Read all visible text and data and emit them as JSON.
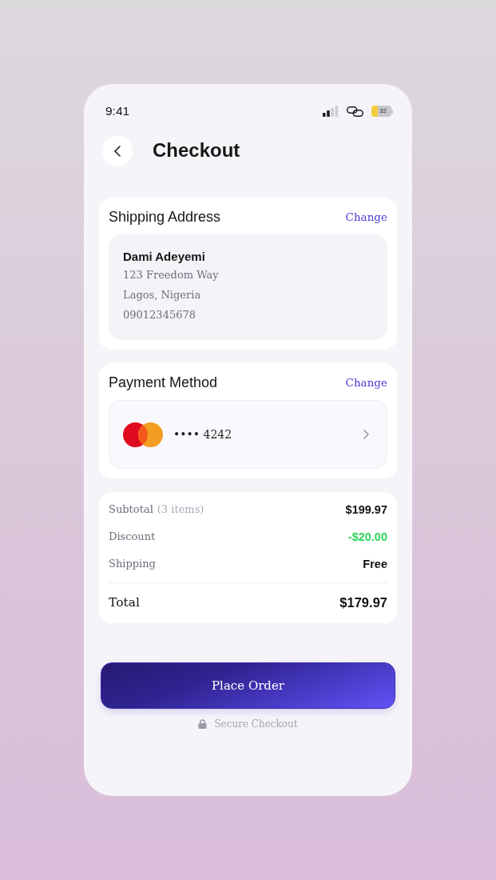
{
  "status_bar": {
    "time": "9:41",
    "battery": "32"
  },
  "header": {
    "title": "Checkout"
  },
  "shipping_address": {
    "title": "Shipping Address",
    "action": "Change",
    "name": "Dami Adeyemi",
    "lines": [
      "123 Freedom Way",
      "Lagos, Nigeria",
      "09012345678"
    ]
  },
  "payment_method": {
    "title": "Payment Method",
    "action": "Change",
    "card_number": "•••• 4242"
  },
  "order_summary": {
    "rows": [
      {
        "kind": "amount",
        "label": "Subtotal",
        "note": "(3 items)",
        "value": "$199.97"
      },
      {
        "kind": "discount",
        "label": "Discount",
        "value": "-$20.00"
      },
      {
        "kind": "amount",
        "label": "Shipping",
        "value": "Free"
      }
    ],
    "total": {
      "label": "Total",
      "value": "$179.97"
    }
  },
  "place_order_button": "Place Order",
  "security_note": "Secure Checkout"
}
